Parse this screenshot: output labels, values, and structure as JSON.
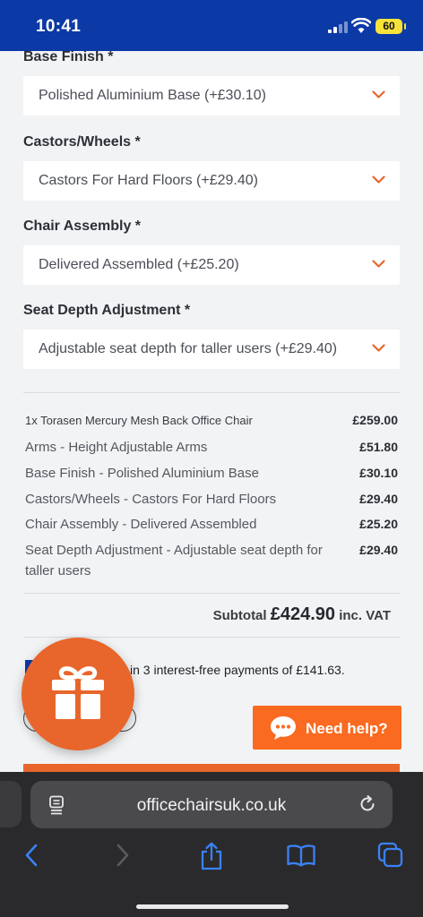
{
  "status_bar": {
    "time": "10:41",
    "battery": "60"
  },
  "options": [
    {
      "label": "Base Finish *",
      "value": "Polished Aluminium Base (+£30.10)"
    },
    {
      "label": "Castors/Wheels *",
      "value": "Castors For Hard Floors (+£29.40)"
    },
    {
      "label": "Chair Assembly *",
      "value": "Delivered Assembled (+£25.20)"
    },
    {
      "label": "Seat Depth Adjustment *",
      "value": "Adjustable seat depth for taller users (+£29.40)"
    }
  ],
  "summary": [
    {
      "desc": "1x Torasen Mercury Mesh Back Office Chair",
      "price": "£259.00"
    },
    {
      "desc": "Arms - Height Adjustable Arms",
      "price": "£51.80"
    },
    {
      "desc": "Base Finish - Polished Aluminium Base",
      "price": "£30.10"
    },
    {
      "desc": "Castors/Wheels - Castors For Hard Floors",
      "price": "£29.40"
    },
    {
      "desc": "Chair Assembly - Delivered Assembled",
      "price": "£25.20"
    },
    {
      "desc": "Seat Depth Adjustment - Adjustable seat depth for taller users",
      "price": "£29.40"
    }
  ],
  "subtotal": {
    "label": "Subtotal",
    "amount": "£424.90",
    "suffix": "inc. VAT"
  },
  "installments_text": "in 3 interest-free payments of £141.63.",
  "help_button": {
    "label": "Need help?"
  },
  "browser": {
    "url": "officechairsuk.co.uk"
  },
  "icons": {
    "gift": "gift-icon",
    "chat": "chat-bubble-icon",
    "reader": "reader-mode-icon",
    "reload": "reload-icon",
    "back": "back-arrow-icon",
    "forward": "forward-arrow-icon",
    "share": "share-icon",
    "bookmarks": "bookmarks-icon",
    "tabs": "tabs-icon"
  },
  "colors": {
    "brand_blue": "#0b39a6",
    "accent_orange": "#e8662b",
    "help_orange": "#fa6a20",
    "safari_blue": "#3a82f6"
  }
}
